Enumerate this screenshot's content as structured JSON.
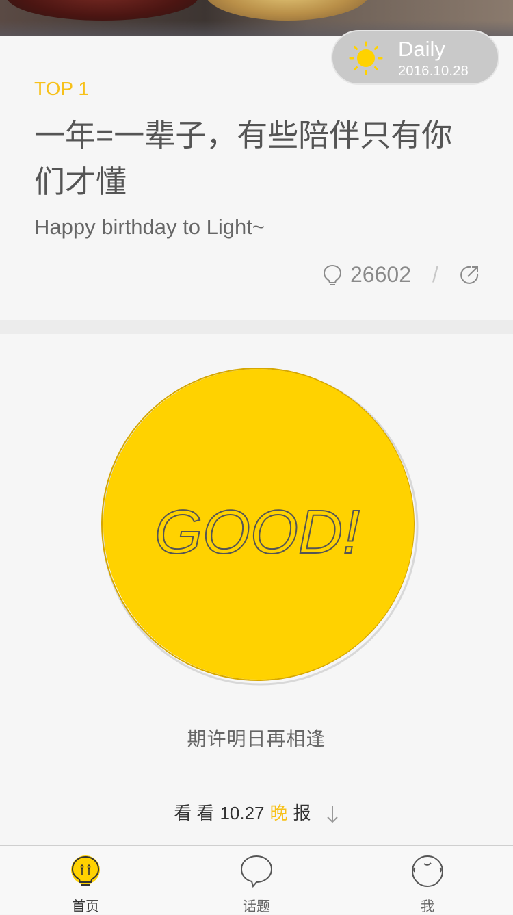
{
  "daily": {
    "title": "Daily",
    "date": "2016.10.28"
  },
  "article": {
    "rank": "TOP 1",
    "headline": "一年=一辈子，有些陪伴只有你们才懂",
    "subtitle": "Happy birthday to Light~",
    "likes": "26602",
    "separator": "/"
  },
  "good_button": {
    "label": "GOOD!",
    "color": "#ffd200"
  },
  "farewell": "期许明日再相逢",
  "evening_report": {
    "prefix": "看 看",
    "date": "10.27",
    "highlight": "晚",
    "suffix": "报"
  },
  "tabs": [
    {
      "label": "首页",
      "icon": "bulb-icon",
      "active": true
    },
    {
      "label": "话题",
      "icon": "speech-bubble-icon",
      "active": false
    },
    {
      "label": "我",
      "icon": "face-icon",
      "active": false
    }
  ],
  "colors": {
    "accent": "#f7c11a",
    "good_yellow": "#ffd200",
    "background": "#f6f6f6"
  }
}
